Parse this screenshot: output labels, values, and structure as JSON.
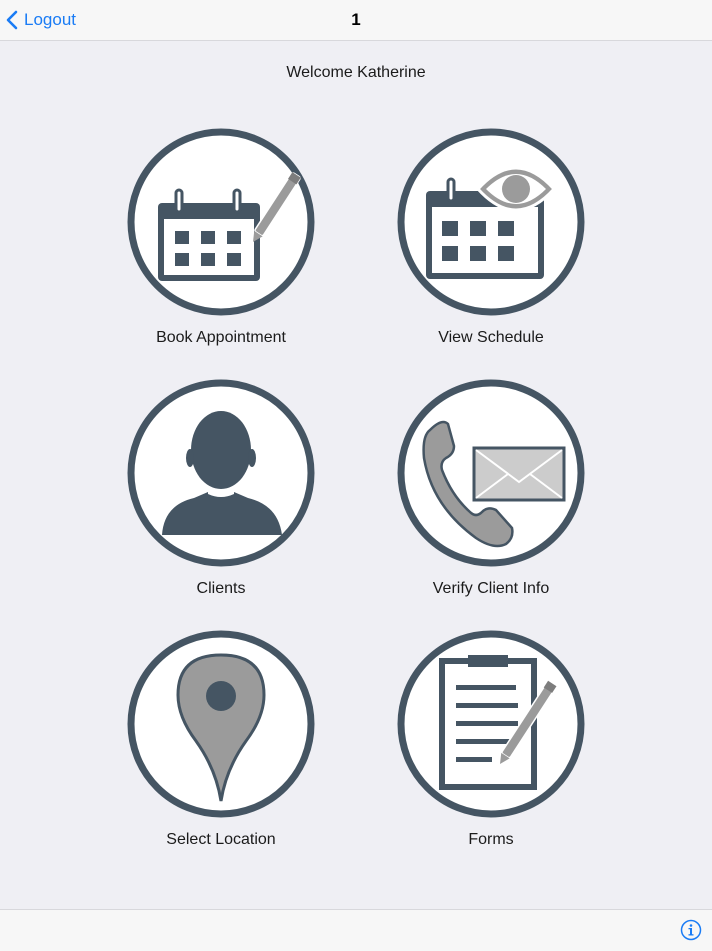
{
  "navbar": {
    "back_label": "Logout",
    "title": "1"
  },
  "welcome_text": "Welcome Katherine",
  "tiles": [
    {
      "label": "Book Appointment",
      "icon": "calendar-pen-icon"
    },
    {
      "label": "View Schedule",
      "icon": "calendar-eye-icon"
    },
    {
      "label": "Clients",
      "icon": "person-icon"
    },
    {
      "label": "Verify Client Info",
      "icon": "phone-envelope-icon"
    },
    {
      "label": "Select Location",
      "icon": "map-pin-icon"
    },
    {
      "label": "Forms",
      "icon": "clipboard-pen-icon"
    }
  ],
  "toolbar": {
    "info_icon": "info-icon"
  },
  "colors": {
    "accent": "#1a7cf5",
    "icon_dark": "#455563",
    "icon_gray": "#9b9b9b",
    "background": "#efeff4"
  }
}
